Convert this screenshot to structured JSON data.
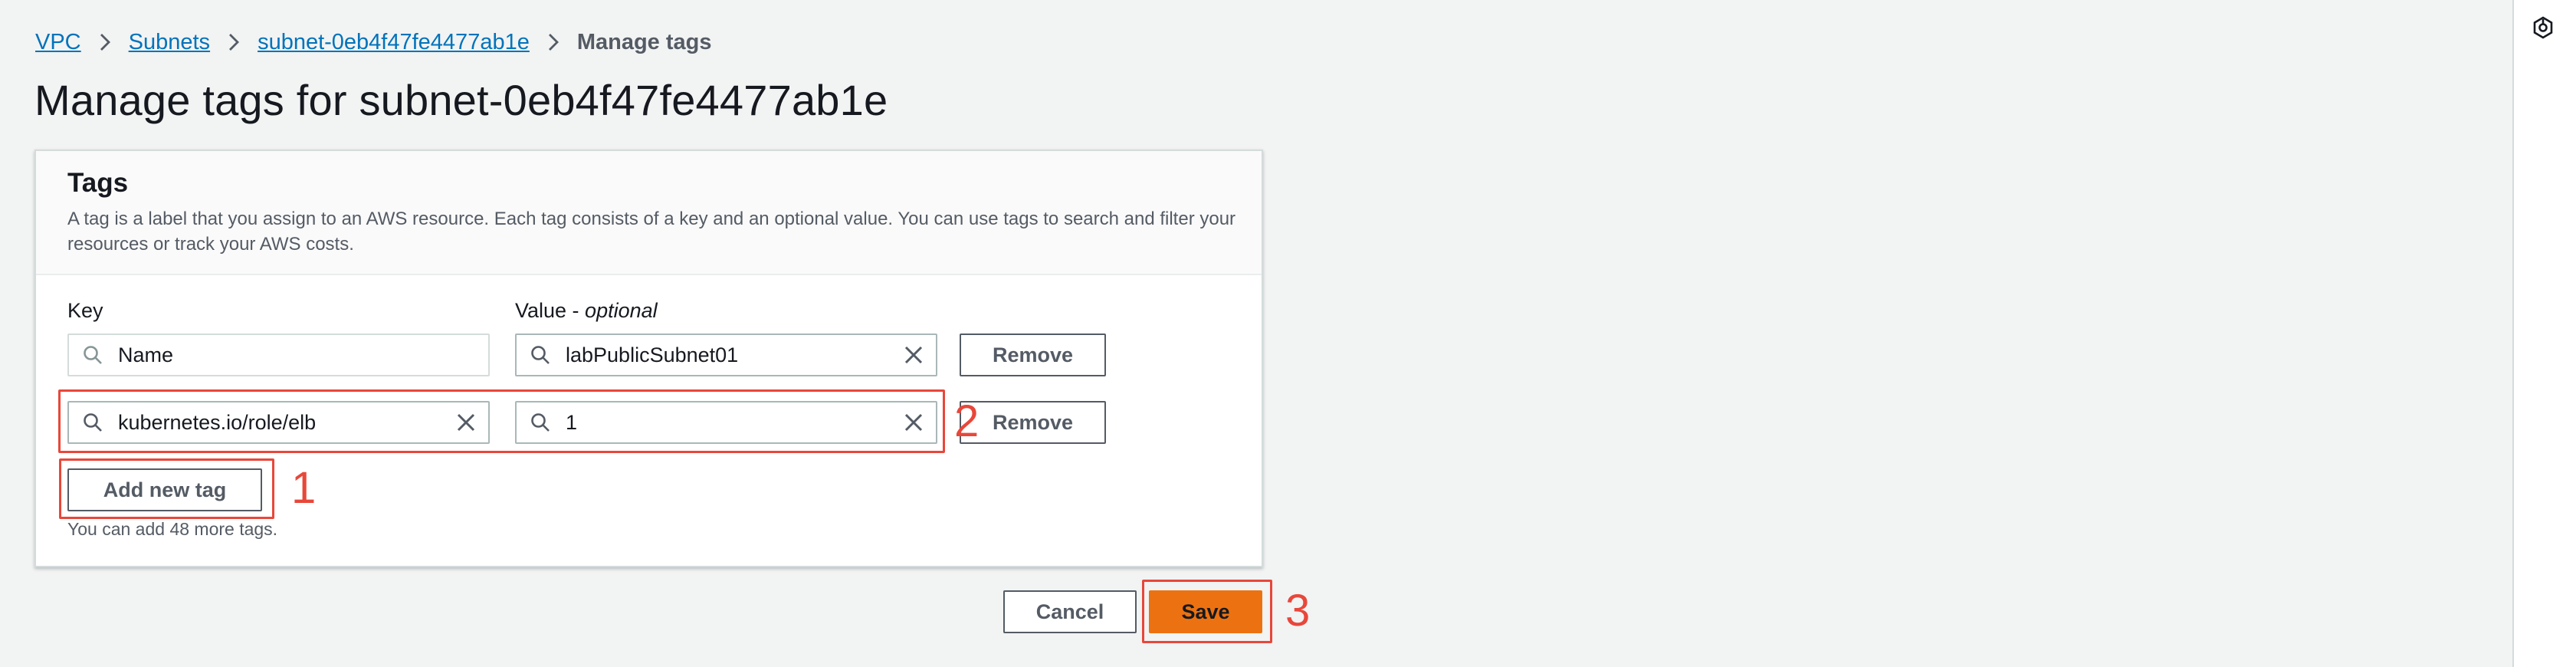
{
  "breadcrumb": {
    "items": [
      "VPC",
      "Subnets",
      "subnet-0eb4f47fe4477ab1e"
    ],
    "current": "Manage tags"
  },
  "page": {
    "title": "Manage tags for subnet-0eb4f47fe4477ab1e"
  },
  "tags_panel": {
    "title": "Tags",
    "description": "A tag is a label that you assign to an AWS resource. Each tag consists of a key and an optional value. You can use tags to search and filter your resources or track your AWS costs.",
    "key_label": "Key",
    "value_label": "Value - ",
    "value_label_optional": "optional",
    "rows": [
      {
        "key": "Name",
        "value": "labPublicSubnet01",
        "remove_label": "Remove"
      },
      {
        "key": "kubernetes.io/role/elb",
        "value": "1",
        "remove_label": "Remove"
      }
    ],
    "add_button_label": "Add new tag",
    "remaining_hint": "You can add 48 more tags."
  },
  "footer": {
    "cancel_label": "Cancel",
    "save_label": "Save"
  },
  "annotations": [
    "1",
    "2",
    "3"
  ],
  "colors": {
    "link": "#0073bb",
    "primary": "#ec7211",
    "annotation": "#e8473a"
  },
  "icons": {
    "rail": "settings-hex-icon",
    "field": "search-icon",
    "clear": "close-icon",
    "separator": "chevron-right-icon"
  }
}
